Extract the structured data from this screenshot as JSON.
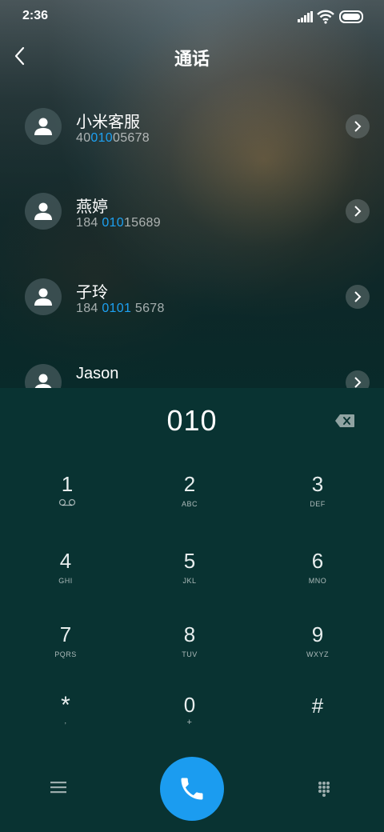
{
  "status": {
    "time": "2:36"
  },
  "header": {
    "title": "通话"
  },
  "contacts": [
    {
      "name": "小米客服",
      "number_pre": "40",
      "number_hl": "010",
      "number_post": "05678"
    },
    {
      "name": "燕婷",
      "number_pre": "184 ",
      "number_hl": "010",
      "number_post": "15689"
    },
    {
      "name": "子玲",
      "number_pre": "184 ",
      "number_hl": "0101",
      "number_post": " 5678"
    },
    {
      "name": "Jason",
      "number_pre": "",
      "number_hl": "",
      "number_post": ""
    }
  ],
  "dialer": {
    "input": "010",
    "keys": [
      {
        "digit": "1",
        "letters": ""
      },
      {
        "digit": "2",
        "letters": "ABC"
      },
      {
        "digit": "3",
        "letters": "DEF"
      },
      {
        "digit": "4",
        "letters": "GHI"
      },
      {
        "digit": "5",
        "letters": "JKL"
      },
      {
        "digit": "6",
        "letters": "MNO"
      },
      {
        "digit": "7",
        "letters": "PQRS"
      },
      {
        "digit": "8",
        "letters": "TUV"
      },
      {
        "digit": "9",
        "letters": "WXYZ"
      },
      {
        "digit": "*",
        "letters": ","
      },
      {
        "digit": "0",
        "letters": "+"
      },
      {
        "digit": "#",
        "letters": ""
      }
    ]
  },
  "colors": {
    "accent": "#1b9cf0",
    "highlight": "#1da1f2",
    "dial_bg": "#093332"
  },
  "icons": {
    "back": "back-chevron-icon",
    "voicemail": "voicemail-icon",
    "backspace": "backspace-icon",
    "menu": "menu-icon",
    "call": "phone-icon",
    "keypad": "keypad-grid-icon"
  }
}
